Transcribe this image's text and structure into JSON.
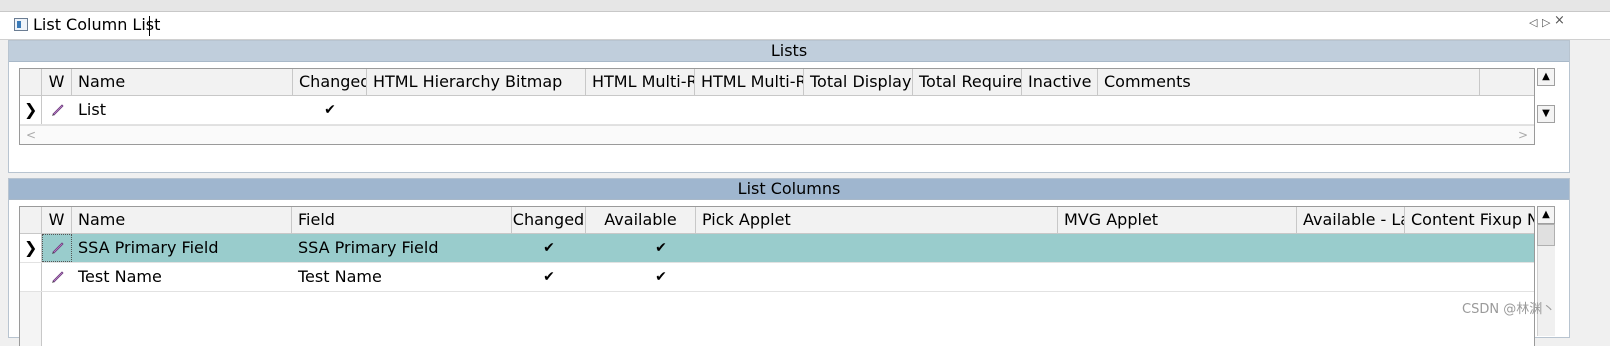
{
  "tab": {
    "title": "List Column List",
    "prev_icon": "triangle-left",
    "next_icon": "triangle-right",
    "close_icon": "×"
  },
  "lists": {
    "title": "Lists",
    "columns": [
      "W",
      "Name",
      "Changed",
      "HTML Hierarchy Bitmap",
      "HTML Multi-Re",
      "HTML Multi-Re",
      "Total Displaye",
      "Total Require",
      "Inactive",
      "Comments"
    ],
    "rows": [
      {
        "name": "List",
        "changed": "✔",
        "html_hierarchy_bitmap": "",
        "html_multi_1": "",
        "html_multi_2": "",
        "total_displayed": "",
        "total_required": "",
        "inactive": "",
        "comments": ""
      }
    ]
  },
  "list_columns": {
    "title": "List Columns",
    "columns": [
      "W",
      "Name",
      "Field",
      "Changed",
      "Available",
      "Pick Applet",
      "MVG Applet",
      "Available - Lar",
      "Content Fixup Na"
    ],
    "rows": [
      {
        "name": "SSA Primary Field",
        "field": "SSA Primary Field",
        "changed": "✔",
        "available": "✔",
        "pick_applet": "",
        "mvg_applet": "",
        "available_lang": "",
        "content_fixup": "",
        "selected": true
      },
      {
        "name": "Test Name",
        "field": "Test Name",
        "changed": "✔",
        "available": "✔",
        "pick_applet": "",
        "mvg_applet": "",
        "available_lang": "",
        "content_fixup": "",
        "selected": false
      }
    ]
  },
  "colors": {
    "lists_header_bg": "#c0cedc",
    "list_columns_header_bg": "#9fb6cf",
    "selected_row": "#99cccc"
  },
  "watermark": "CSDN @林渊丶"
}
